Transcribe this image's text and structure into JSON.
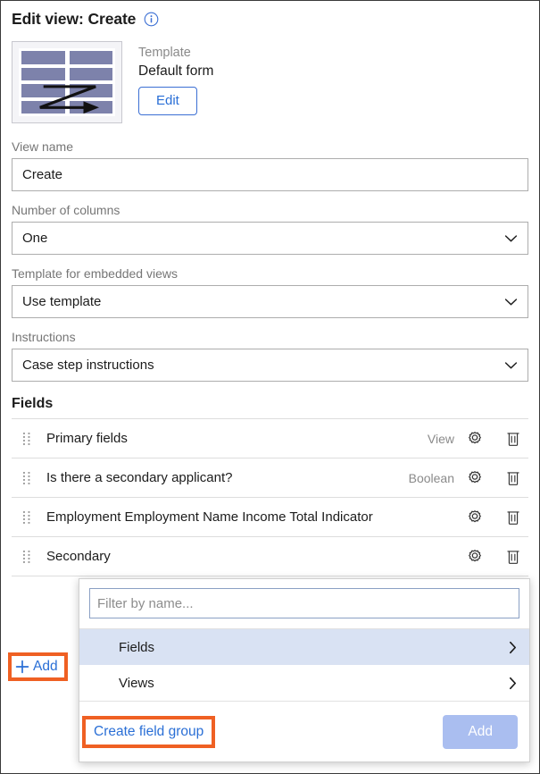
{
  "header": {
    "title": "Edit view: Create",
    "info_icon": "info-circle-icon"
  },
  "template": {
    "thumbnail_icon": "default-form-template-thumbnail",
    "label": "Template",
    "value": "Default form",
    "edit_label": "Edit"
  },
  "form": {
    "view_name": {
      "label": "View name",
      "value": "Create"
    },
    "number_of_columns": {
      "label": "Number of columns",
      "value": "One",
      "chevron_icon": "chevron-down-icon"
    },
    "template_for_embedded_views": {
      "label": "Template for embedded views",
      "value": "Use template",
      "chevron_icon": "chevron-down-icon"
    },
    "instructions": {
      "label": "Instructions",
      "value": "Case step instructions",
      "chevron_icon": "chevron-down-icon"
    }
  },
  "fields": {
    "heading": "Fields",
    "rows": [
      {
        "name": "Primary fields",
        "type": "View"
      },
      {
        "name": "Is there a secondary applicant?",
        "type": "Boolean"
      },
      {
        "name": "Employment Employment Name Income Total Indicator",
        "type": ""
      },
      {
        "name": "Secondary",
        "type": ""
      }
    ],
    "drag_icon": "drag-handle-icon",
    "gear_icon": "gear-icon",
    "trash_icon": "trash-icon"
  },
  "add": {
    "label": "Add",
    "plus_icon": "plus-icon"
  },
  "popup": {
    "filter_placeholder": "Filter by name...",
    "filter_value": "",
    "menu_items": [
      {
        "label": "Fields",
        "chevron_icon": "chevron-right-icon",
        "active": true
      },
      {
        "label": "Views",
        "chevron_icon": "chevron-right-icon",
        "active": false
      }
    ],
    "create_field_group_label": "Create field group",
    "add_button_label": "Add"
  },
  "colors": {
    "link": "#2a6fd6",
    "highlight_box": "#ef6023",
    "menu_active_bg": "#d9e2f3",
    "disabled_button": "#aabef0",
    "thumbnail_bar": "#7d82ab"
  }
}
